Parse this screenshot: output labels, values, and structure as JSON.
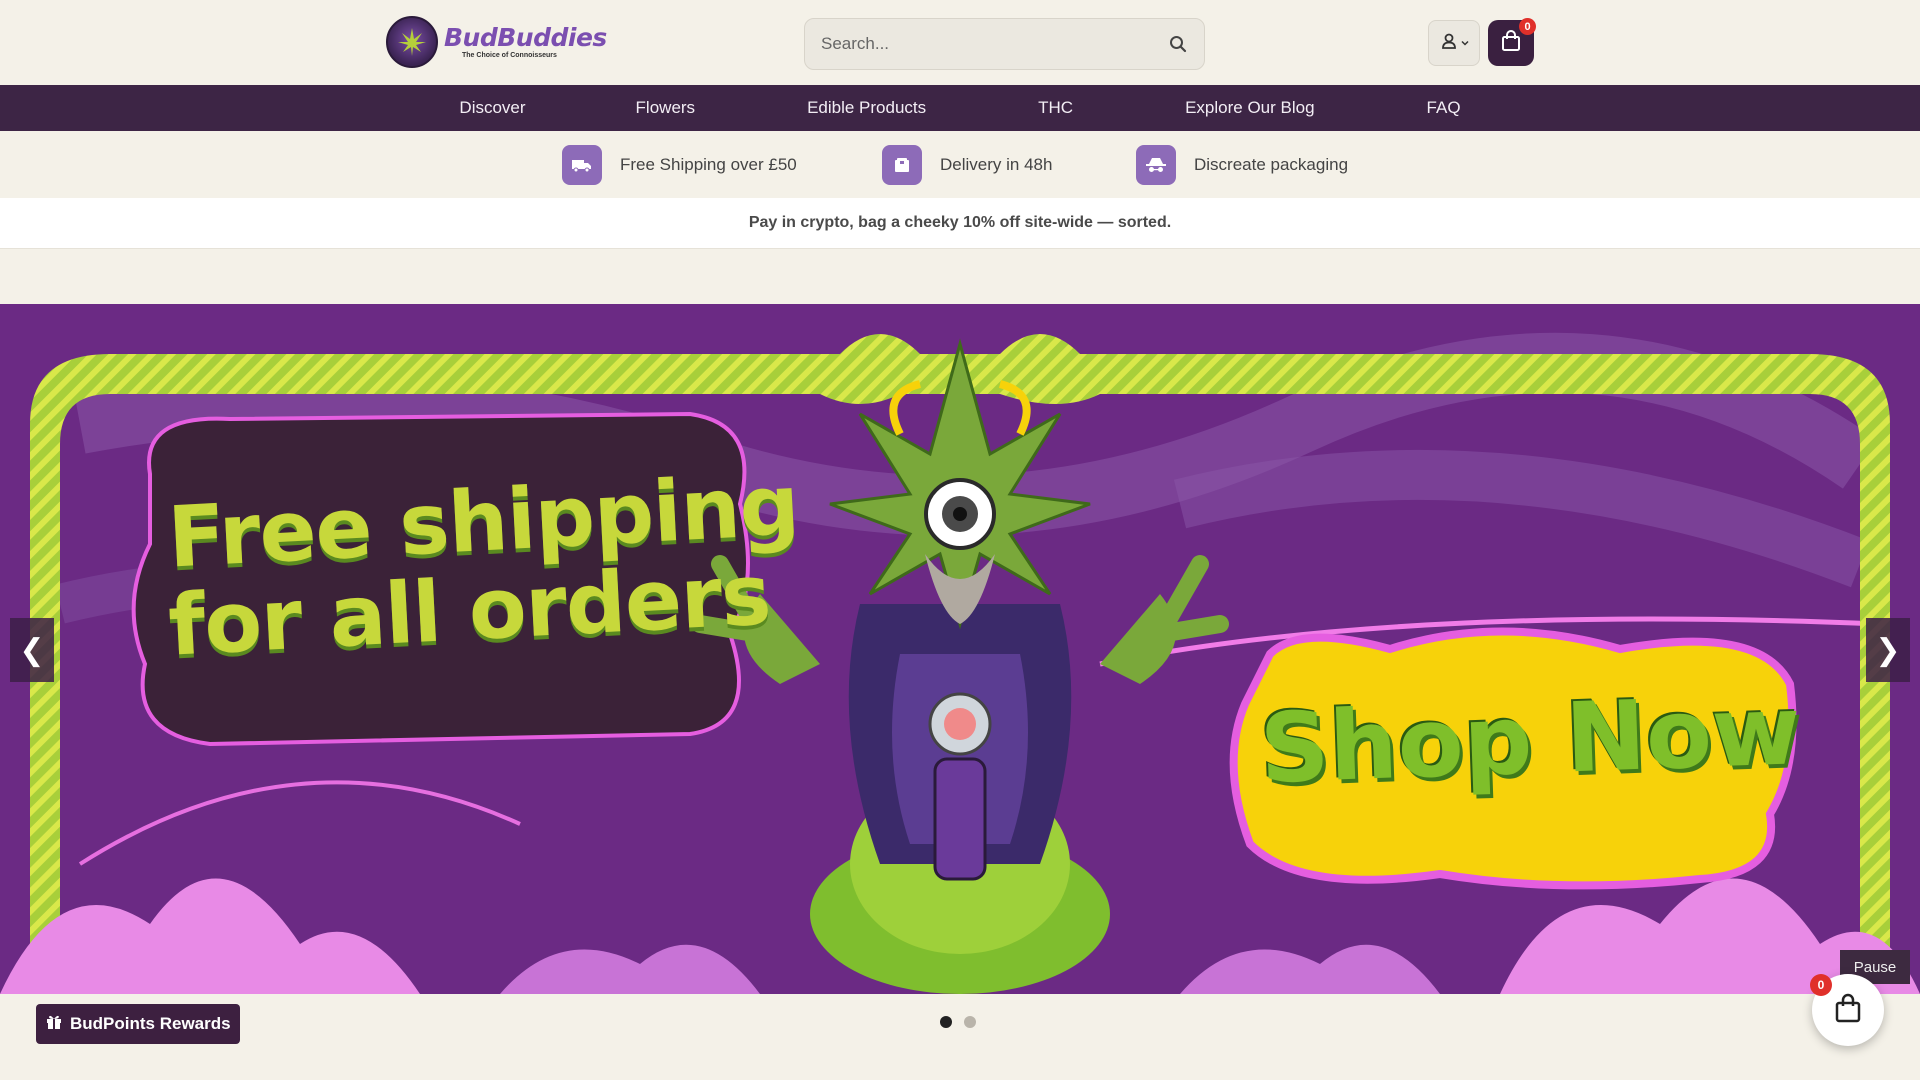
{
  "brand": {
    "name": "BudBuddies",
    "tagline": "The Choice of Connoisseurs"
  },
  "search": {
    "placeholder": "Search..."
  },
  "cart": {
    "count": "0"
  },
  "nav": {
    "items": [
      {
        "label": "Discover"
      },
      {
        "label": "Flowers"
      },
      {
        "label": "Edible Products"
      },
      {
        "label": "THC"
      },
      {
        "label": "Explore Our Blog"
      },
      {
        "label": "FAQ"
      }
    ]
  },
  "features": [
    {
      "text": "Free Shipping over £50",
      "icon": "truck-icon"
    },
    {
      "text": "Delivery in 48h",
      "icon": "package-icon"
    },
    {
      "text": "Discreate packaging",
      "icon": "incognito-icon"
    }
  ],
  "promo": {
    "text": "Pay in crypto, bag a cheeky 10% off site-wide — sorted."
  },
  "hero": {
    "headline_line1": "Free shipping",
    "headline_line2": "for all orders",
    "cta": "Shop Now",
    "prev_arrow": "❮",
    "next_arrow": "❯",
    "pause_label": "Pause",
    "slide_count": 2,
    "active_slide": 1
  },
  "rewards": {
    "label": "BudPoints Rewards"
  },
  "floating_cart": {
    "count": "0"
  },
  "colors": {
    "page_bg": "#f4f1e8",
    "nav_bg": "#3d2545",
    "accent_purple": "#8d6bb8",
    "hero_purple": "#6a2a82",
    "lime": "#c7d83b",
    "badge_red": "#e0302a"
  }
}
